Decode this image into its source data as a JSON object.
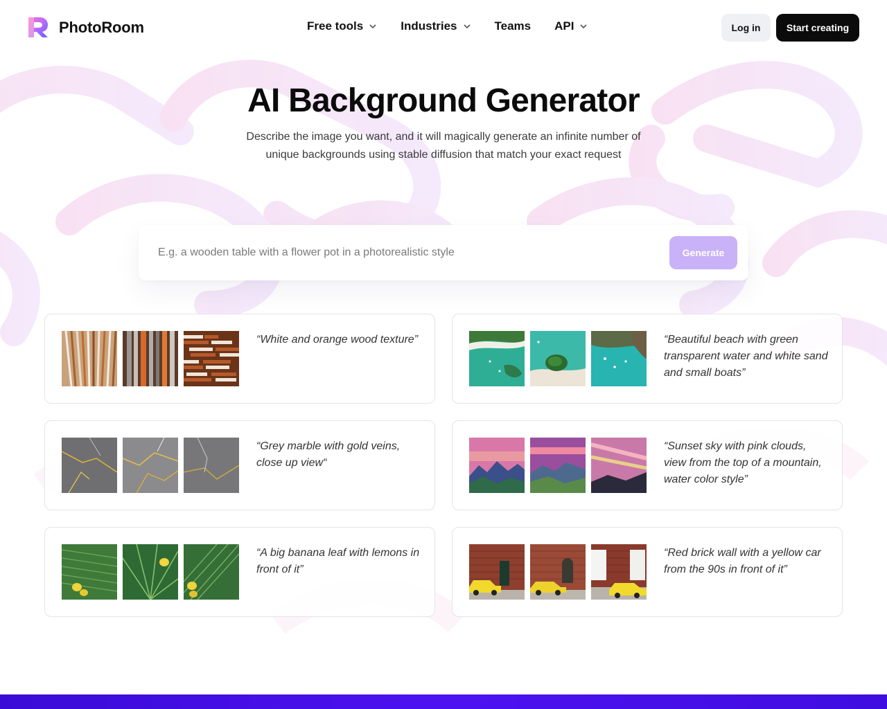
{
  "brand": {
    "name": "PhotoRoom"
  },
  "nav": {
    "items": [
      {
        "label": "Free tools",
        "has_dropdown": true
      },
      {
        "label": "Industries",
        "has_dropdown": true
      },
      {
        "label": "Teams",
        "has_dropdown": false
      },
      {
        "label": "API",
        "has_dropdown": true
      }
    ],
    "login_label": "Log in",
    "start_label": "Start creating"
  },
  "hero": {
    "title": "AI Background Generator",
    "subtitle": "Describe the image you want, and it will magically generate an infinite number of unique backgrounds using stable diffusion that match your exact request"
  },
  "search": {
    "placeholder": "E.g. a wooden table with a flower pot in a photorealistic style",
    "value": "",
    "button_label": "Generate"
  },
  "examples": [
    {
      "prompt": "“White and orange wood texture”",
      "theme": "wood"
    },
    {
      "prompt": "“Beautiful beach with green transparent water and white sand and small boats”",
      "theme": "beach"
    },
    {
      "prompt": "“Grey marble with gold veins, close up view“",
      "theme": "marble"
    },
    {
      "prompt": "“Sunset sky with pink clouds, view from the top of a mountain, water color style”",
      "theme": "sunset"
    },
    {
      "prompt": "“A big banana leaf with lemons in front of it”",
      "theme": "leaf"
    },
    {
      "prompt": "“Red brick wall with a yellow car from the 90s in front of it”",
      "theme": "brick"
    }
  ],
  "colors": {
    "accent": "#c9b2f7",
    "primary_button": "#0b0b0b",
    "bottom_band": "#3a0bd6"
  }
}
